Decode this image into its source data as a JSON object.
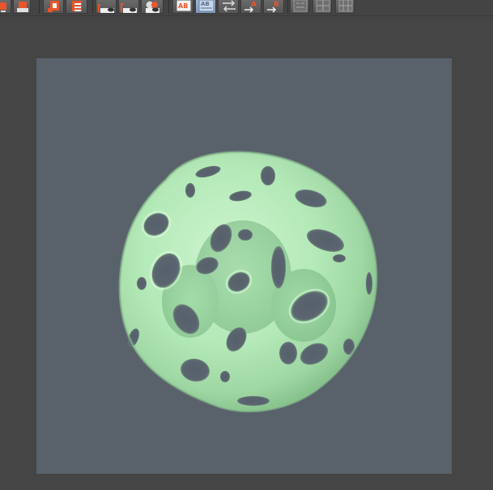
{
  "toolbar": {
    "buttons": [
      {
        "name": "toolbar-button-1",
        "icon": "object-link-icon",
        "active": false
      },
      {
        "name": "toolbar-button-2",
        "icon": "object-save-icon",
        "active": false
      },
      {
        "name": "toolbar-button-3",
        "icon": "layer-stack-icon",
        "active": false
      },
      {
        "name": "toolbar-button-4",
        "icon": "layer-list-icon",
        "active": false
      },
      {
        "name": "toolbar-button-5",
        "icon": "view-eye-icon",
        "active": false
      },
      {
        "name": "toolbar-button-6",
        "icon": "view-eye-red-icon",
        "active": false
      },
      {
        "name": "toolbar-button-7",
        "icon": "render-view-icon",
        "active": false
      },
      {
        "name": "toolbar-button-8",
        "icon": "ab-compare-icon",
        "active": false,
        "label": "AB"
      },
      {
        "name": "toolbar-button-9",
        "icon": "ab-swap-icon",
        "active": true,
        "label": "AB"
      },
      {
        "name": "toolbar-button-10",
        "icon": "swap-arrows-icon",
        "active": false
      },
      {
        "name": "toolbar-button-11",
        "icon": "goto-a-icon",
        "active": false,
        "label": "A"
      },
      {
        "name": "toolbar-button-12",
        "icon": "goto-b-icon",
        "active": false,
        "label": "B"
      },
      {
        "name": "toolbar-button-13",
        "icon": "ab-layout-icon",
        "active": false
      },
      {
        "name": "toolbar-button-14",
        "icon": "grid-layout-icon",
        "active": false
      },
      {
        "name": "toolbar-button-15",
        "icon": "grid-split-icon",
        "active": false
      }
    ]
  },
  "viewport": {
    "object": "perforated-sphere",
    "background_color": "#59626b",
    "object_color": "#b4e8b8"
  },
  "colors": {
    "accent_orange": "#e8562a",
    "active_blue": "#8fa7cb"
  }
}
